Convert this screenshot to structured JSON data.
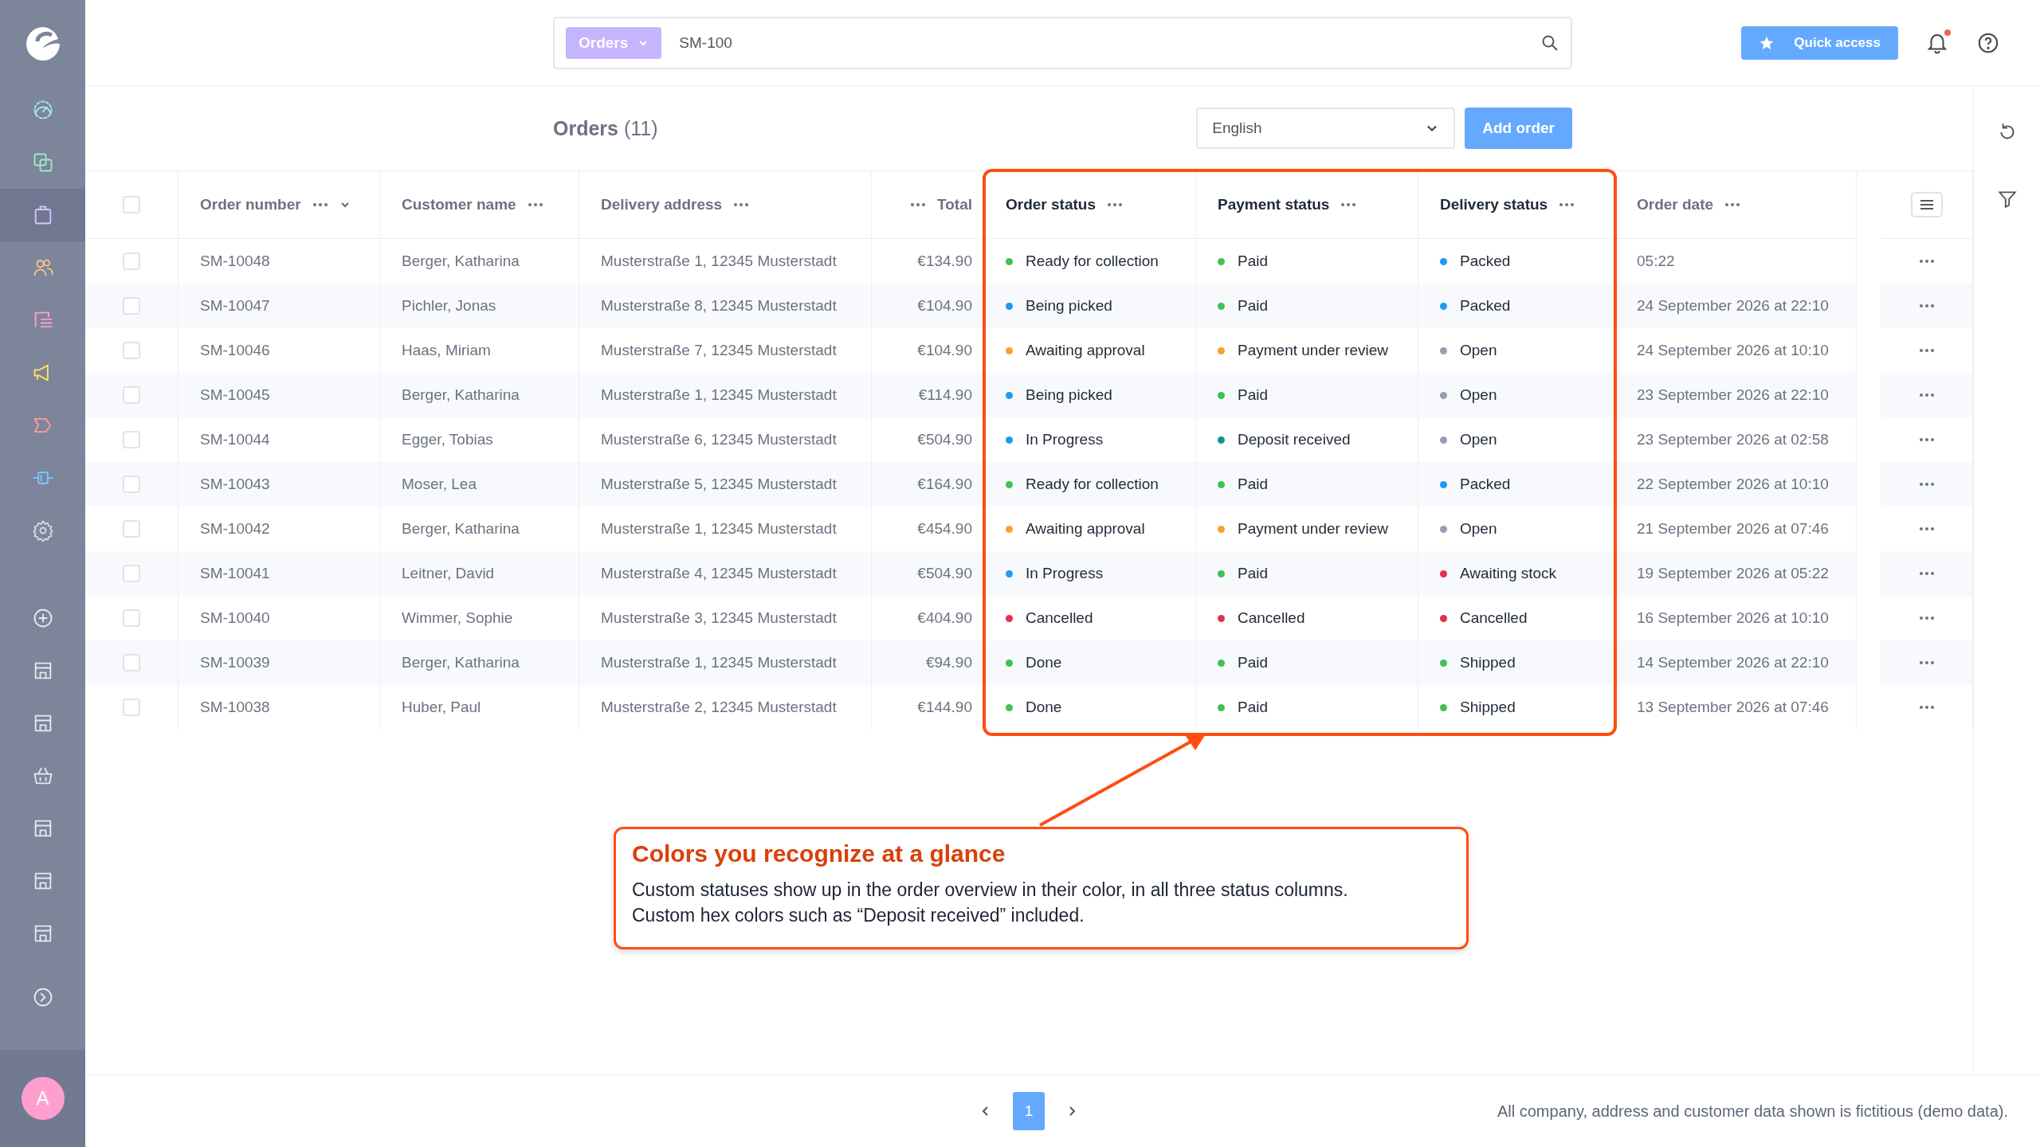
{
  "sidebar": {
    "items": [
      {
        "selected": false
      },
      {
        "selected": false
      },
      {
        "selected": true
      },
      {
        "selected": false
      },
      {
        "selected": false
      },
      {
        "selected": false
      },
      {
        "selected": false
      },
      {
        "selected": false
      },
      {
        "selected": false
      },
      {
        "selected": false
      },
      {
        "selected": false
      },
      {
        "selected": false
      },
      {
        "selected": false
      },
      {
        "selected": false
      },
      {
        "selected": false
      },
      {
        "selected": false
      },
      {
        "selected": false
      }
    ],
    "avatar": "A"
  },
  "search": {
    "scope": "Orders",
    "value": "SM-100"
  },
  "quick_access": "Quick access",
  "notifications": {
    "unread": true
  },
  "page": {
    "title": "Orders",
    "count": "(11)",
    "language": "English",
    "add_button": "Add order"
  },
  "select_all": {
    "checked": false
  },
  "columns": [
    {
      "label": "Order number",
      "highlighted": false,
      "sorted": true
    },
    {
      "label": "Customer name",
      "highlighted": false,
      "sorted": false
    },
    {
      "label": "Delivery address",
      "highlighted": false,
      "sorted": false
    },
    {
      "label": "Total",
      "highlighted": false,
      "sorted": false
    },
    {
      "label": "Order status",
      "highlighted": true,
      "sorted": false
    },
    {
      "label": "Payment status",
      "highlighted": true,
      "sorted": false
    },
    {
      "label": "Delivery status",
      "highlighted": true,
      "sorted": false
    },
    {
      "label": "Order date",
      "highlighted": false,
      "sorted": false
    }
  ],
  "rows": [
    {
      "checked": false,
      "order_number": "SM-10048",
      "customer": "Berger, Katharina",
      "address": "Musterstraße 1, 12345 Musterstadt",
      "total": "€134.90",
      "order_status": {
        "label": "Ready for collection",
        "color": "#3ec254"
      },
      "payment_status": {
        "label": "Paid",
        "color": "#3ec254"
      },
      "delivery_status": {
        "label": "Packed",
        "color": "#1e9bf0"
      },
      "order_date": "05:22"
    },
    {
      "checked": false,
      "order_number": "SM-10047",
      "customer": "Pichler, Jonas",
      "address": "Musterstraße 8, 12345 Musterstadt",
      "total": "€104.90",
      "order_status": {
        "label": "Being picked",
        "color": "#1e9bf0"
      },
      "payment_status": {
        "label": "Paid",
        "color": "#3ec254"
      },
      "delivery_status": {
        "label": "Packed",
        "color": "#1e9bf0"
      },
      "order_date": "24 September 2026 at 22:10"
    },
    {
      "checked": false,
      "order_number": "SM-10046",
      "customer": "Haas, Miriam",
      "address": "Musterstraße 7, 12345 Musterstadt",
      "total": "€104.90",
      "order_status": {
        "label": "Awaiting approval",
        "color": "#f5a524"
      },
      "payment_status": {
        "label": "Payment under review",
        "color": "#f5a524"
      },
      "delivery_status": {
        "label": "Open",
        "color": "#94a0b2"
      },
      "order_date": "24 September 2026 at 10:10"
    },
    {
      "checked": false,
      "order_number": "SM-10045",
      "customer": "Berger, Katharina",
      "address": "Musterstraße 1, 12345 Musterstadt",
      "total": "€114.90",
      "order_status": {
        "label": "Being picked",
        "color": "#1e9bf0"
      },
      "payment_status": {
        "label": "Paid",
        "color": "#3ec254"
      },
      "delivery_status": {
        "label": "Open",
        "color": "#94a0b2"
      },
      "order_date": "23 September 2026 at 22:10"
    },
    {
      "checked": false,
      "order_number": "SM-10044",
      "customer": "Egger, Tobias",
      "address": "Musterstraße 6, 12345 Musterstadt",
      "total": "€504.90",
      "order_status": {
        "label": "In Progress",
        "color": "#1e9bf0"
      },
      "payment_status": {
        "label": "Deposit received",
        "color": "#129390"
      },
      "delivery_status": {
        "label": "Open",
        "color": "#94a0b2"
      },
      "order_date": "23 September 2026 at 02:58"
    },
    {
      "checked": false,
      "order_number": "SM-10043",
      "customer": "Moser, Lea",
      "address": "Musterstraße 5, 12345 Musterstadt",
      "total": "€164.90",
      "order_status": {
        "label": "Ready for collection",
        "color": "#3ec254"
      },
      "payment_status": {
        "label": "Paid",
        "color": "#3ec254"
      },
      "delivery_status": {
        "label": "Packed",
        "color": "#1e9bf0"
      },
      "order_date": "22 September 2026 at 10:10"
    },
    {
      "checked": false,
      "order_number": "SM-10042",
      "customer": "Berger, Katharina",
      "address": "Musterstraße 1, 12345 Musterstadt",
      "total": "€454.90",
      "order_status": {
        "label": "Awaiting approval",
        "color": "#f5a524"
      },
      "payment_status": {
        "label": "Payment under review",
        "color": "#f5a524"
      },
      "delivery_status": {
        "label": "Open",
        "color": "#94a0b2"
      },
      "order_date": "21 September 2026 at 07:46"
    },
    {
      "checked": false,
      "order_number": "SM-10041",
      "customer": "Leitner, David",
      "address": "Musterstraße 4, 12345 Musterstadt",
      "total": "€504.90",
      "order_status": {
        "label": "In Progress",
        "color": "#1e9bf0"
      },
      "payment_status": {
        "label": "Paid",
        "color": "#3ec254"
      },
      "delivery_status": {
        "label": "Awaiting stock",
        "color": "#e5304c"
      },
      "order_date": "19 September 2026 at 05:22"
    },
    {
      "checked": false,
      "order_number": "SM-10040",
      "customer": "Wimmer, Sophie",
      "address": "Musterstraße 3, 12345 Musterstadt",
      "total": "€404.90",
      "order_status": {
        "label": "Cancelled",
        "color": "#e5304c"
      },
      "payment_status": {
        "label": "Cancelled",
        "color": "#e5304c"
      },
      "delivery_status": {
        "label": "Cancelled",
        "color": "#e5304c"
      },
      "order_date": "16 September 2026 at 10:10"
    },
    {
      "checked": false,
      "order_number": "SM-10039",
      "customer": "Berger, Katharina",
      "address": "Musterstraße 1, 12345 Musterstadt",
      "total": "€94.90",
      "order_status": {
        "label": "Done",
        "color": "#3ec254"
      },
      "payment_status": {
        "label": "Paid",
        "color": "#3ec254"
      },
      "delivery_status": {
        "label": "Shipped",
        "color": "#3ec254"
      },
      "order_date": "14 September 2026 at 22:10"
    },
    {
      "checked": false,
      "order_number": "SM-10038",
      "customer": "Huber, Paul",
      "address": "Musterstraße 2, 12345 Musterstadt",
      "total": "€144.90",
      "order_status": {
        "label": "Done",
        "color": "#3ec254"
      },
      "payment_status": {
        "label": "Paid",
        "color": "#3ec254"
      },
      "delivery_status": {
        "label": "Shipped",
        "color": "#3ec254"
      },
      "order_date": "13 September 2026 at 07:46"
    }
  ],
  "callout": {
    "title": "Colors you recognize at a glance",
    "lines": [
      "Custom statuses show up in the order overview in their color, in all three status columns.",
      "Custom hex colors such as “Deposit received” included."
    ]
  },
  "pagination": [
    {
      "label": "1",
      "selected": true
    }
  ],
  "footer_note": "All company, address and customer data shown is fictitious (demo data)."
}
